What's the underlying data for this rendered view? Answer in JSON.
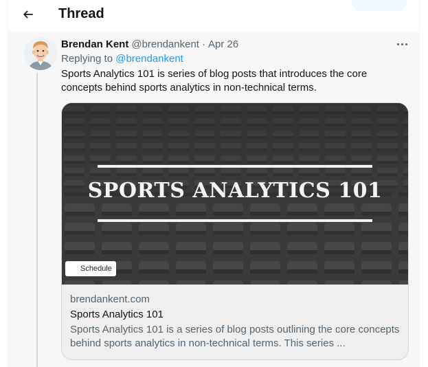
{
  "header": {
    "title": "Thread",
    "back_icon": "arrow-left-icon"
  },
  "tweet": {
    "author_name": "Brendan Kent",
    "author_handle": "@brendankent",
    "separator": "·",
    "date": "Apr 26",
    "replying_prefix": "Replying to ",
    "replying_handle": "@brendankent",
    "text": "Sports Analytics 101 is series of blog posts that introduces the core concepts behind sports analytics in non-technical terms.",
    "more_icon": "more-horizontal-icon",
    "avatar_icon": "cartoon-avatar"
  },
  "card": {
    "image_title": "SPORTS ANALYTICS 101",
    "chip_label": "Schedule",
    "domain": "brendankent.com",
    "title": "Sports Analytics 101",
    "description": "Sports Analytics 101 is a series of blog posts outlining the core concepts behind sports analytics in non-technical terms. This series ..."
  },
  "colors": {
    "link": "#1d9bf0",
    "secondary_text": "#536471",
    "primary_text": "#0f1419",
    "banner_background": "#3b3b3b"
  }
}
